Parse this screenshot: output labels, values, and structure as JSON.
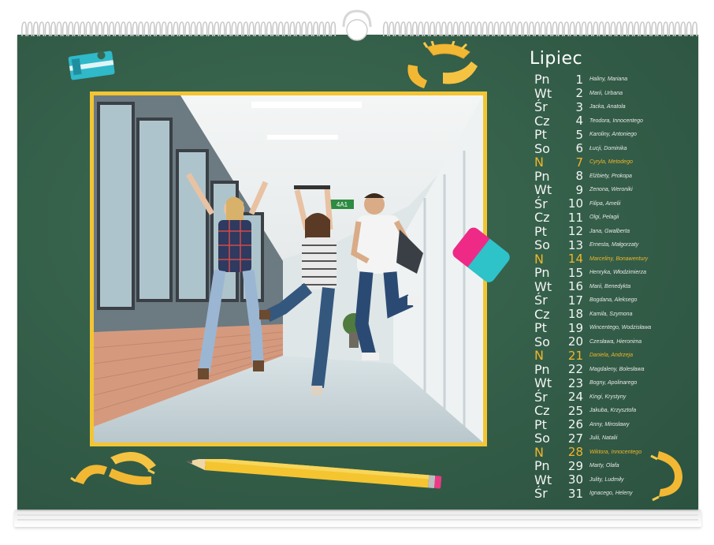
{
  "calendar": {
    "month": "Lipiec",
    "days": [
      {
        "abbr": "Pn",
        "day": "1",
        "names": "Haliny, Mariana",
        "sunday": false
      },
      {
        "abbr": "Wt",
        "day": "2",
        "names": "Marii, Urbana",
        "sunday": false
      },
      {
        "abbr": "Śr",
        "day": "3",
        "names": "Jacka, Anatola",
        "sunday": false
      },
      {
        "abbr": "Cz",
        "day": "4",
        "names": "Teodora, Innocentego",
        "sunday": false
      },
      {
        "abbr": "Pt",
        "day": "5",
        "names": "Karoliny, Antoniego",
        "sunday": false
      },
      {
        "abbr": "So",
        "day": "6",
        "names": "Łucji, Dominika",
        "sunday": false
      },
      {
        "abbr": "N",
        "day": "7",
        "names": "Cyryla, Metodego",
        "sunday": true
      },
      {
        "abbr": "Pn",
        "day": "8",
        "names": "Elżbiety, Prokopa",
        "sunday": false
      },
      {
        "abbr": "Wt",
        "day": "9",
        "names": "Zenona, Weroniki",
        "sunday": false
      },
      {
        "abbr": "Śr",
        "day": "10",
        "names": "Filipa, Amelii",
        "sunday": false
      },
      {
        "abbr": "Cz",
        "day": "11",
        "names": "Olgi, Pelagii",
        "sunday": false
      },
      {
        "abbr": "Pt",
        "day": "12",
        "names": "Jana, Gwalberta",
        "sunday": false
      },
      {
        "abbr": "So",
        "day": "13",
        "names": "Ernesta, Małgorzaty",
        "sunday": false
      },
      {
        "abbr": "N",
        "day": "14",
        "names": "Marceliny, Bonawentury",
        "sunday": true
      },
      {
        "abbr": "Pn",
        "day": "15",
        "names": "Henryka, Włodzimierza",
        "sunday": false
      },
      {
        "abbr": "Wt",
        "day": "16",
        "names": "Marii, Benedykta",
        "sunday": false
      },
      {
        "abbr": "Śr",
        "day": "17",
        "names": "Bogdana, Aleksego",
        "sunday": false
      },
      {
        "abbr": "Cz",
        "day": "18",
        "names": "Kamila, Szymona",
        "sunday": false
      },
      {
        "abbr": "Pt",
        "day": "19",
        "names": "Wincentego, Wodzisława",
        "sunday": false
      },
      {
        "abbr": "So",
        "day": "20",
        "names": "Czesława, Hieronima",
        "sunday": false
      },
      {
        "abbr": "N",
        "day": "21",
        "names": "Daniela, Andrzeja",
        "sunday": true
      },
      {
        "abbr": "Pn",
        "day": "22",
        "names": "Magdaleny, Bolesława",
        "sunday": false
      },
      {
        "abbr": "Wt",
        "day": "23",
        "names": "Bogny, Apolinarego",
        "sunday": false
      },
      {
        "abbr": "Śr",
        "day": "24",
        "names": "Kingi, Krystyny",
        "sunday": false
      },
      {
        "abbr": "Cz",
        "day": "25",
        "names": "Jakuba, Krzysztofa",
        "sunday": false
      },
      {
        "abbr": "Pt",
        "day": "26",
        "names": "Anny, Mirosławy",
        "sunday": false
      },
      {
        "abbr": "So",
        "day": "27",
        "names": "Julii, Natalii",
        "sunday": false
      },
      {
        "abbr": "N",
        "day": "28",
        "names": "Wiktora, Innocentego",
        "sunday": true
      },
      {
        "abbr": "Pn",
        "day": "29",
        "names": "Marty, Olafa",
        "sunday": false
      },
      {
        "abbr": "Wt",
        "day": "30",
        "names": "Julity, Ludmiły",
        "sunday": false
      },
      {
        "abbr": "Śr",
        "day": "31",
        "names": "Ignacego, Heleny",
        "sunday": false
      }
    ]
  },
  "photo": {
    "exit_sign_text": "4A1"
  },
  "colors": {
    "board": "#35604a",
    "frame": "#f3c533",
    "sunday": "#f0b52a",
    "eraser_pink": "#ee2a86",
    "eraser_teal": "#2ec2c9"
  }
}
